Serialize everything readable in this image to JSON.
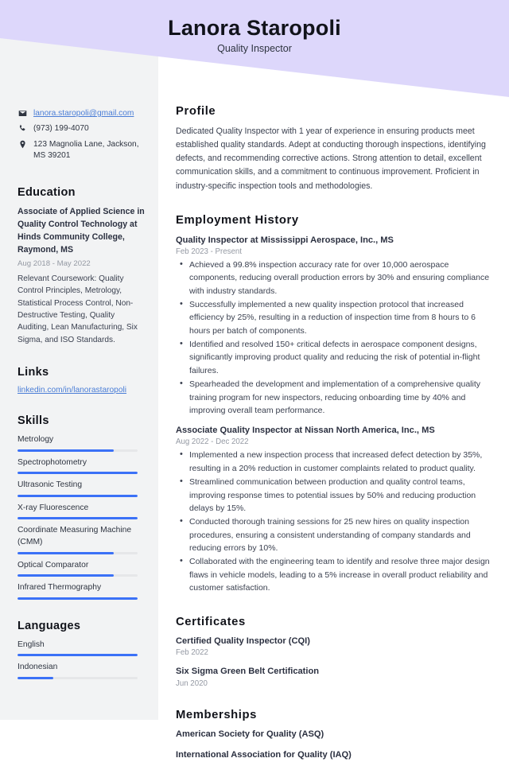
{
  "header": {
    "name": "Lanora Staropoli",
    "job_title": "Quality Inspector",
    "band_color": "#ddd7fb"
  },
  "sidebar": {
    "contact": {
      "email": "lanora.staropoli@gmail.com",
      "phone": "(973) 199-4070",
      "address": "123 Magnolia Lane, Jackson, MS 39201"
    },
    "education": {
      "heading": "Education",
      "degree": "Associate of Applied Science in Quality Control Technology at Hinds Community College, Raymond, MS",
      "date": "Aug 2018 - May 2022",
      "description": "Relevant Coursework: Quality Control Principles, Metrology, Statistical Process Control, Non-Destructive Testing, Quality Auditing, Lean Manufacturing, Six Sigma, and ISO Standards."
    },
    "links": {
      "heading": "Links",
      "items": [
        {
          "label": "linkedin.com/in/lanorastaropoli"
        }
      ]
    },
    "skills": {
      "heading": "Skills",
      "accent_color": "#3b71f7",
      "items": [
        {
          "label": "Metrology",
          "level": 80
        },
        {
          "label": "Spectrophotometry",
          "level": 100
        },
        {
          "label": "Ultrasonic Testing",
          "level": 100
        },
        {
          "label": "X-ray Fluorescence",
          "level": 100
        },
        {
          "label": "Coordinate Measuring Machine (CMM)",
          "level": 80
        },
        {
          "label": "Optical Comparator",
          "level": 80
        },
        {
          "label": "Infrared Thermography",
          "level": 100
        }
      ]
    },
    "languages": {
      "heading": "Languages",
      "items": [
        {
          "label": "English",
          "level": 100
        },
        {
          "label": "Indonesian",
          "level": 30
        }
      ]
    }
  },
  "main": {
    "profile": {
      "heading": "Profile",
      "text": "Dedicated Quality Inspector with 1 year of experience in ensuring products meet established quality standards. Adept at conducting thorough inspections, identifying defects, and recommending corrective actions. Strong attention to detail, excellent communication skills, and a commitment to continuous improvement. Proficient in industry-specific inspection tools and methodologies."
    },
    "employment": {
      "heading": "Employment History",
      "jobs": [
        {
          "title": "Quality Inspector at Mississippi Aerospace, Inc., MS",
          "date": "Feb 2023 - Present",
          "bullets": [
            "Achieved a 99.8% inspection accuracy rate for over 10,000 aerospace components, reducing overall production errors by 30% and ensuring compliance with industry standards.",
            "Successfully implemented a new quality inspection protocol that increased efficiency by 25%, resulting in a reduction of inspection time from 8 hours to 6 hours per batch of components.",
            "Identified and resolved 150+ critical defects in aerospace component designs, significantly improving product quality and reducing the risk of potential in-flight failures.",
            "Spearheaded the development and implementation of a comprehensive quality training program for new inspectors, reducing onboarding time by 40% and improving overall team performance."
          ]
        },
        {
          "title": "Associate Quality Inspector at Nissan North America, Inc., MS",
          "date": "Aug 2022 - Dec 2022",
          "bullets": [
            "Implemented a new inspection process that increased defect detection by 35%, resulting in a 20% reduction in customer complaints related to product quality.",
            "Streamlined communication between production and quality control teams, improving response times to potential issues by 50% and reducing production delays by 15%.",
            "Conducted thorough training sessions for 25 new hires on quality inspection procedures, ensuring a consistent understanding of company standards and reducing errors by 10%.",
            "Collaborated with the engineering team to identify and resolve three major design flaws in vehicle models, leading to a 5% increase in overall product reliability and customer satisfaction."
          ]
        }
      ]
    },
    "certificates": {
      "heading": "Certificates",
      "items": [
        {
          "title": "Certified Quality Inspector (CQI)",
          "date": "Feb 2022"
        },
        {
          "title": "Six Sigma Green Belt Certification",
          "date": "Jun 2020"
        }
      ]
    },
    "memberships": {
      "heading": "Memberships",
      "items": [
        {
          "title": "American Society for Quality (ASQ)"
        },
        {
          "title": "International Association for Quality (IAQ)"
        }
      ]
    }
  }
}
